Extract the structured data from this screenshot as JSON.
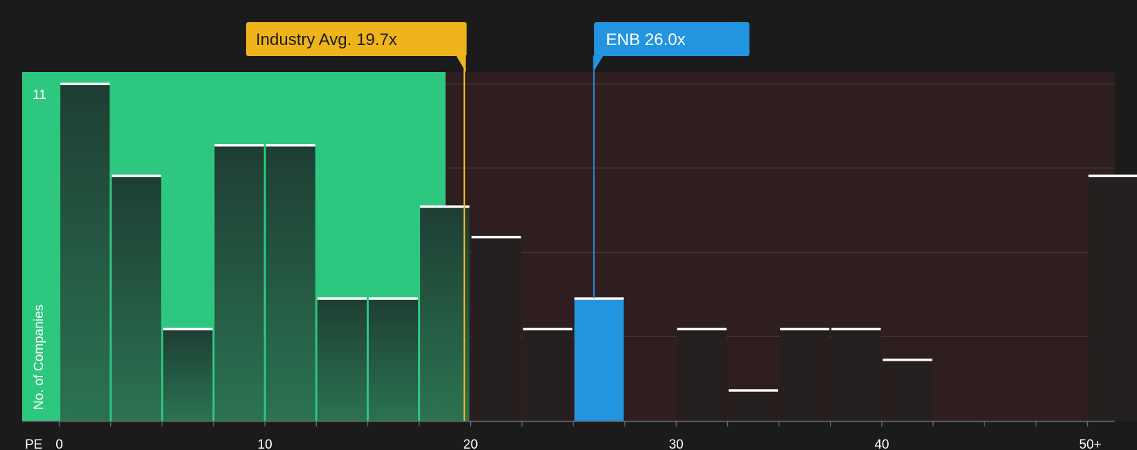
{
  "chart_data": {
    "type": "bar",
    "xlabel": "PE",
    "ylabel": "No. of Companies",
    "y_max_label": "11",
    "ylim": [
      0,
      11
    ],
    "xlim": [
      -0.5,
      51.25
    ],
    "bin_width": 2.5,
    "x_ticks": [
      {
        "value": 0,
        "label": "0"
      },
      {
        "value": 10,
        "label": "10"
      },
      {
        "value": 20,
        "label": "20"
      },
      {
        "value": 30,
        "label": "30"
      },
      {
        "value": 40,
        "label": "40"
      },
      {
        "value": 50,
        "label": "50+"
      }
    ],
    "bins": [
      {
        "start": 0,
        "count": 11
      },
      {
        "start": 2.5,
        "count": 8
      },
      {
        "start": 5,
        "count": 3
      },
      {
        "start": 7.5,
        "count": 9
      },
      {
        "start": 10,
        "count": 9
      },
      {
        "start": 12.5,
        "count": 4
      },
      {
        "start": 15,
        "count": 4
      },
      {
        "start": 17.5,
        "count": 7
      },
      {
        "start": 20,
        "count": 6
      },
      {
        "start": 22.5,
        "count": 3
      },
      {
        "start": 25,
        "count": 4,
        "highlight": true
      },
      {
        "start": 30,
        "count": 3
      },
      {
        "start": 32.5,
        "count": 1
      },
      {
        "start": 35,
        "count": 3
      },
      {
        "start": 37.5,
        "count": 3
      },
      {
        "start": 40,
        "count": 2
      },
      {
        "start": 50,
        "count": 8
      }
    ],
    "industry_avg": {
      "value": 19.7,
      "label": "Industry Avg. 19.7x"
    },
    "company": {
      "value": 26.0,
      "label": "ENB 26.0x"
    },
    "colors": {
      "background": "#1b1b1b",
      "below_avg_region": "#2ec780",
      "above_avg_region": "#2f1e1f",
      "bar_dark": "#1f3f33",
      "bar_above": "#251f1f",
      "highlight_bar": "#2394e0",
      "industry_avg": "#efb31b",
      "company": "#2394e0",
      "grid": "#4a3a3b",
      "text": "#ffffff"
    }
  }
}
